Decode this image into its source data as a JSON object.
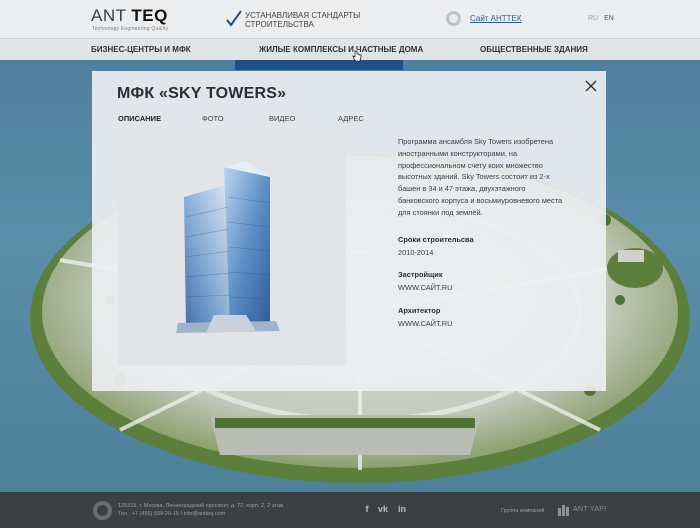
{
  "header": {
    "logo": {
      "text_light": "ANT ",
      "text_bold": "TEQ",
      "tagline": "Technology Engineering Quality"
    },
    "slogan": "устанавливая стандарты строительства",
    "about_link": "Сайт АНТТЕК",
    "languages": [
      {
        "code": "RU",
        "active": false
      },
      {
        "code": "EN",
        "active": true
      }
    ]
  },
  "nav": {
    "items": [
      {
        "label": "Бизнес-центры и МФК",
        "active": false
      },
      {
        "label": "Жилые комплексы и частные дома",
        "active": true
      },
      {
        "label": "Общественные здания",
        "active": false
      }
    ]
  },
  "modal": {
    "title": "МФК «SKY TOWERS»",
    "tabs": [
      {
        "label": "Описание",
        "active": true
      },
      {
        "label": "Фото",
        "active": false
      },
      {
        "label": "Видео",
        "active": false
      },
      {
        "label": "Адрес",
        "active": false
      }
    ],
    "description": "Программа ансамбля Sky Towers изобретена иностранными конструкторами, на профессиональном счету коих множество высотных зданий. Sky Towers состоит из 2-х башен в 34 и 47 этажа, двухэтажного банковского корпуса и восьмиуровневого места для стоянки под землёй.",
    "fields": [
      {
        "label": "Сроки строительсва",
        "value": "2010-2014"
      },
      {
        "label": "Застройщик",
        "value": "WWW.САЙТ.RU"
      },
      {
        "label": "Архитектор",
        "value": "WWW.САЙТ.RU"
      }
    ]
  },
  "footer": {
    "address": "125315, г. Москва, Ленинградский проспект, д. 72, корп. 2, 2 этаж",
    "phone": "Тел.: +7 (495) 589-20-15",
    "separator": "/",
    "email": "info@antteq.com",
    "social": [
      {
        "label": "f",
        "icon": "facebook-icon"
      },
      {
        "label": "vk",
        "icon": "vk-icon"
      },
      {
        "label": "in",
        "icon": "linkedin-icon"
      }
    ],
    "group_label": "Группа компаний",
    "brand": "ANT YAPI"
  },
  "colors": {
    "accent": "#1e5285",
    "link": "#2e5f8f",
    "header_bg": "#ecedee",
    "footer_bg": "#3d3f42"
  }
}
